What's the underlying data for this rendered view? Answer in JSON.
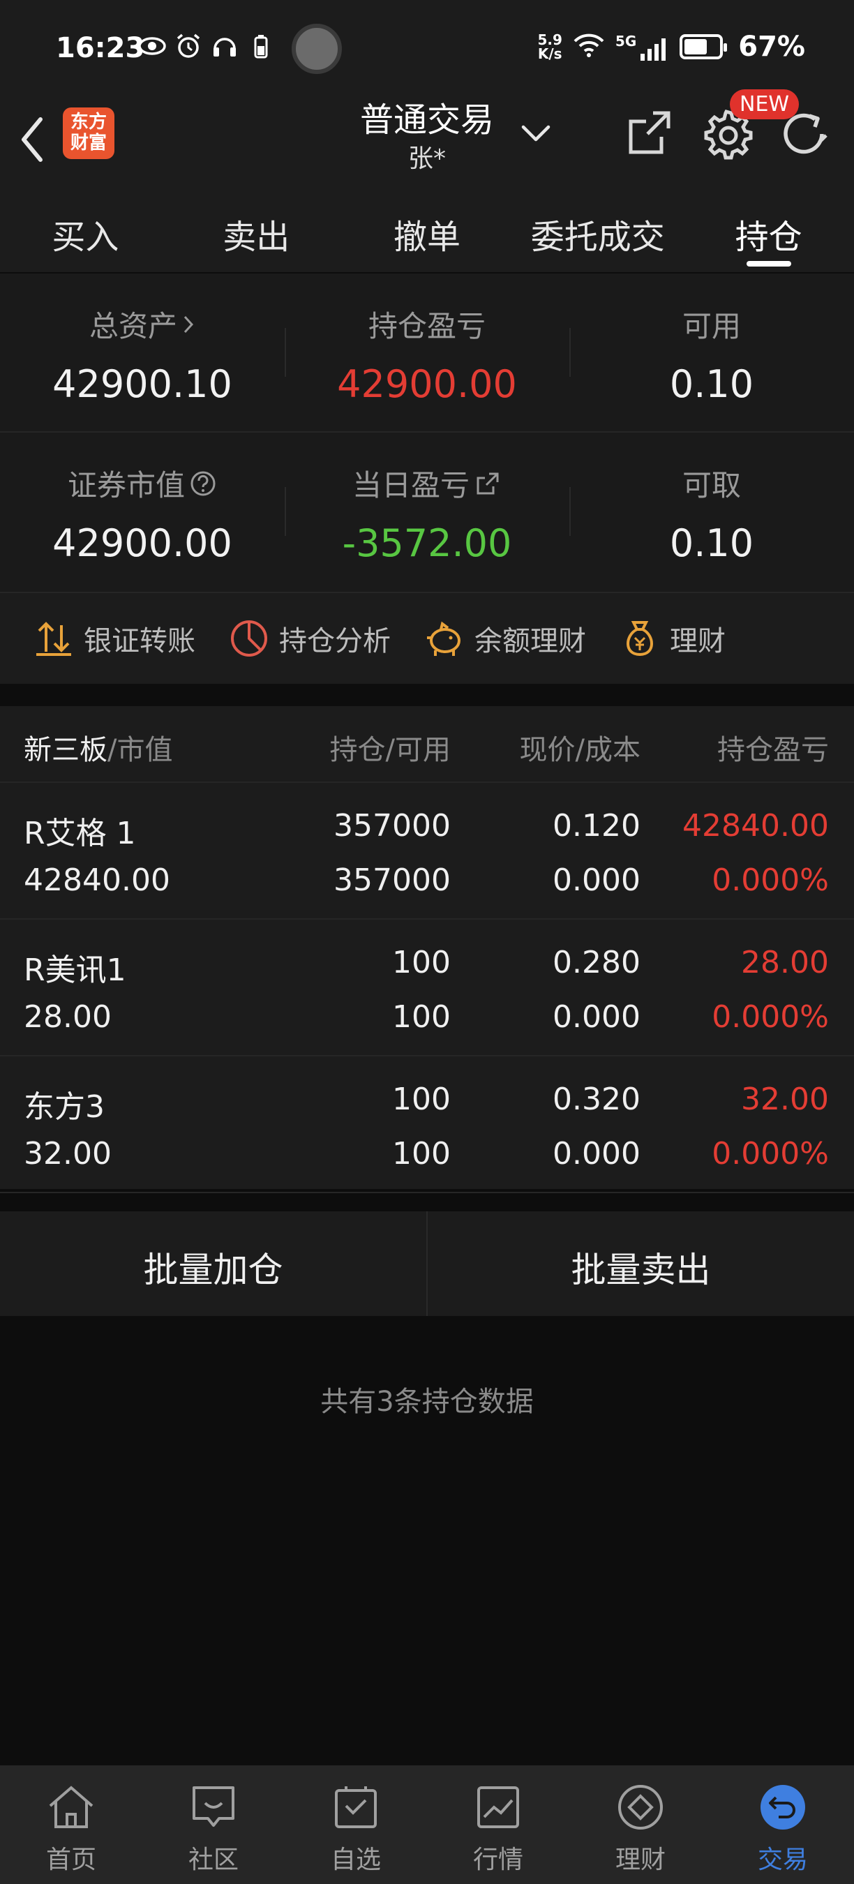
{
  "status_bar": {
    "time": "16:23",
    "network_speed_value": "5.9",
    "network_speed_unit": "K/s",
    "signal_label": "5G",
    "battery_percent": "67%",
    "battery_level": 0.67
  },
  "header": {
    "title": "普通交易",
    "subtitle": "张*",
    "logo_line1": "东方",
    "logo_line2": "财富",
    "new_badge": "NEW"
  },
  "tabs": [
    {
      "label": "买入",
      "active": false
    },
    {
      "label": "卖出",
      "active": false
    },
    {
      "label": "撤单",
      "active": false
    },
    {
      "label": "委托成交",
      "active": false
    },
    {
      "label": "持仓",
      "active": true
    }
  ],
  "summary": {
    "row1": [
      {
        "label": "总资产",
        "value": "42900.10"
      },
      {
        "label": "持仓盈亏",
        "value": "42900.00"
      },
      {
        "label": "可用",
        "value": "0.10"
      }
    ],
    "row2": [
      {
        "label": "证券市值",
        "value": "42900.00"
      },
      {
        "label": "当日盈亏",
        "value": "-3572.00"
      },
      {
        "label": "可取",
        "value": "0.10"
      }
    ]
  },
  "quick_actions": [
    "银证转账",
    "持仓分析",
    "余额理财",
    "理财"
  ],
  "holdings": {
    "headers": {
      "name_market": "新三板",
      "name_market_suffix": "/市值",
      "qty": "持仓/可用",
      "price": "现价/成本",
      "pnl": "持仓盈亏"
    },
    "rows": [
      {
        "name": "R艾格 1",
        "market_value": "42840.00",
        "position": "357000",
        "available": "357000",
        "price": "0.120",
        "cost": "0.000",
        "pnl": "42840.00",
        "pnl_pct": "0.000%"
      },
      {
        "name": "R美讯1",
        "market_value": "28.00",
        "position": "100",
        "available": "100",
        "price": "0.280",
        "cost": "0.000",
        "pnl": "28.00",
        "pnl_pct": "0.000%"
      },
      {
        "name": "东方3",
        "market_value": "32.00",
        "position": "100",
        "available": "100",
        "price": "0.320",
        "cost": "0.000",
        "pnl": "32.00",
        "pnl_pct": "0.000%"
      }
    ]
  },
  "batch": {
    "add_label": "批量加仓",
    "sell_label": "批量卖出"
  },
  "footer_note": "共有3条持仓数据",
  "bottom_nav": [
    {
      "label": "首页",
      "icon": "home-icon",
      "active": false
    },
    {
      "label": "社区",
      "icon": "community-icon",
      "active": false
    },
    {
      "label": "自选",
      "icon": "watchlist-icon",
      "active": false
    },
    {
      "label": "行情",
      "icon": "market-icon",
      "active": false
    },
    {
      "label": "理财",
      "icon": "wealth-icon",
      "active": false
    },
    {
      "label": "交易",
      "icon": "trade-icon",
      "active": true
    }
  ],
  "colors": {
    "up_red": "#e43d34",
    "down_green": "#58c742",
    "accent_blue": "#3f7fe0",
    "logo_orange": "#e9542e",
    "quick_icon_orange": "#e8a23a"
  }
}
